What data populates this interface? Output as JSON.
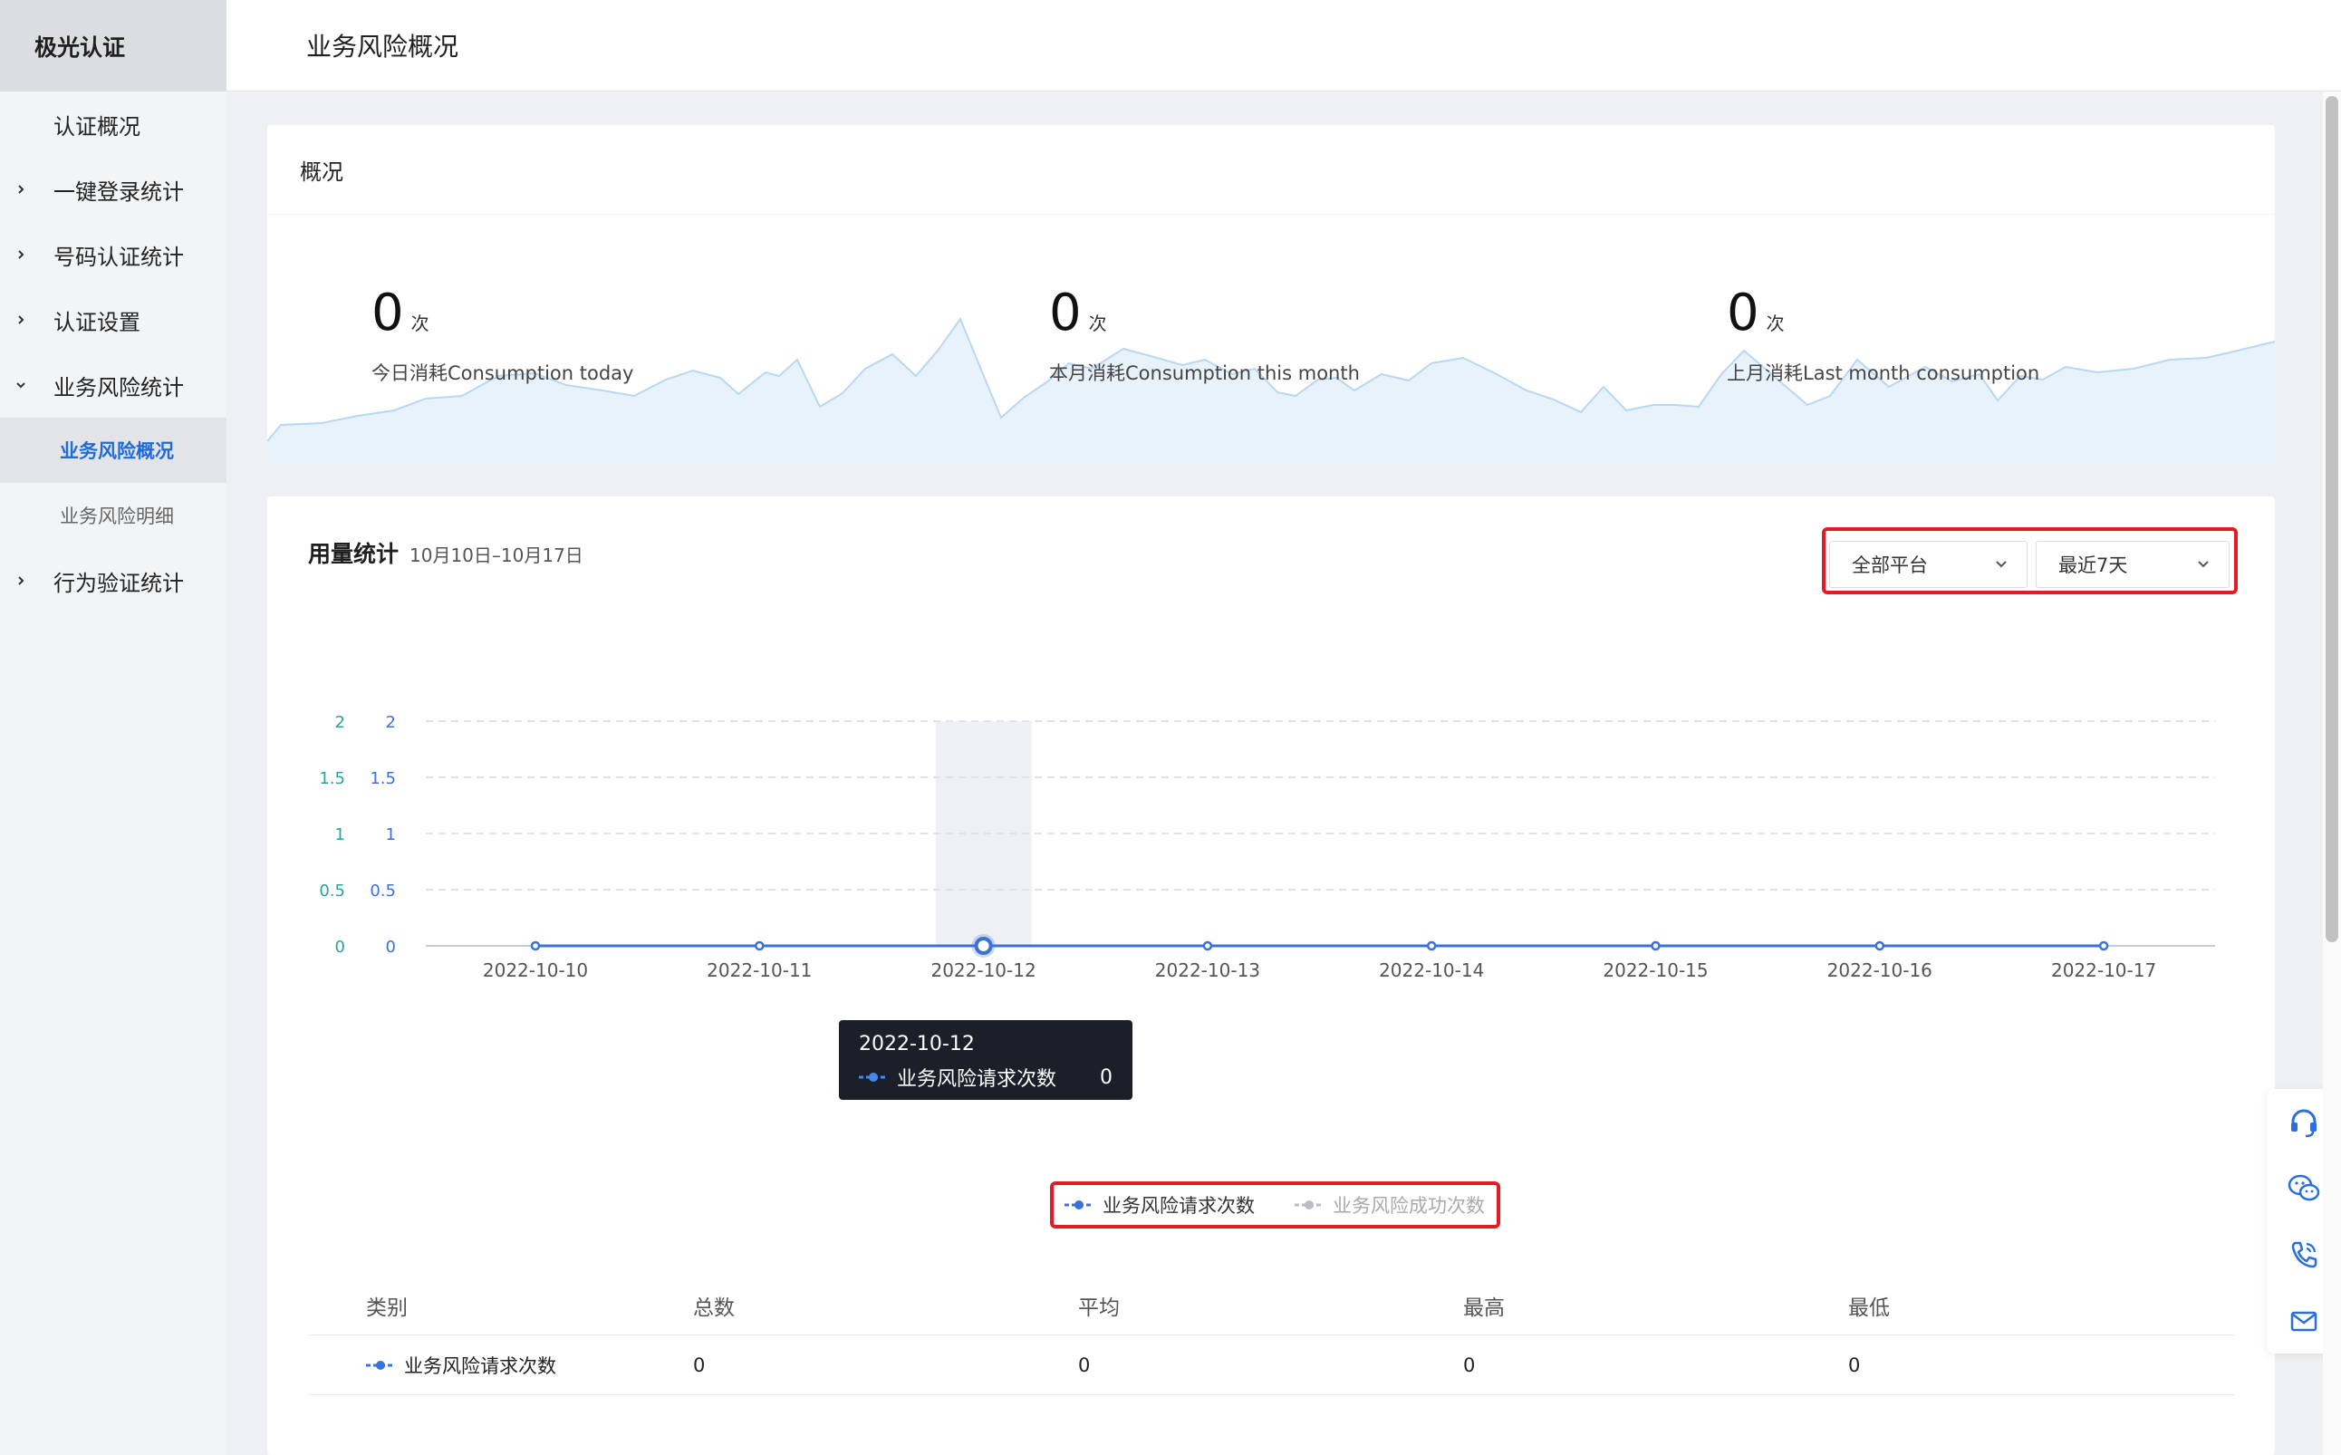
{
  "brand": "极光认证",
  "sidebar": {
    "items": [
      {
        "label": "认证概况"
      },
      {
        "label": "一键登录统计"
      },
      {
        "label": "号码认证统计"
      },
      {
        "label": "认证设置"
      },
      {
        "label": "业务风险统计"
      },
      {
        "label": "行为验证统计"
      }
    ],
    "sub_items": [
      {
        "label": "业务风险概况",
        "active": true
      },
      {
        "label": "业务风险明细",
        "active": false
      }
    ]
  },
  "header": {
    "title": "业务风险概况"
  },
  "overview": {
    "title": "概况",
    "stats": [
      {
        "value": "0",
        "unit": "次",
        "label": "今日消耗Consumption today"
      },
      {
        "value": "0",
        "unit": "次",
        "label": "本月消耗Consumption this month"
      },
      {
        "value": "0",
        "unit": "次",
        "label": "上月消耗Last month consumption"
      }
    ]
  },
  "usage": {
    "title": "用量统计",
    "date_range": "10月10日–10月17日",
    "platform_select": "全部平台",
    "period_select": "最近7天"
  },
  "chart_data": {
    "type": "line",
    "x": [
      "2022-10-10",
      "2022-10-11",
      "2022-10-12",
      "2022-10-13",
      "2022-10-14",
      "2022-10-15",
      "2022-10-16",
      "2022-10-17"
    ],
    "series": [
      {
        "name": "业务风险请求次数",
        "values": [
          0,
          0,
          0,
          0,
          0,
          0,
          0,
          0
        ],
        "color": "#3a72d9",
        "active": true
      },
      {
        "name": "业务风险成功次数",
        "values": [
          0,
          0,
          0,
          0,
          0,
          0,
          0,
          0
        ],
        "color": "#b8bcc4",
        "active": false
      }
    ],
    "y_ticks": [
      "0",
      "0.5",
      "1",
      "1.5",
      "2"
    ],
    "ylim": [
      0,
      2
    ],
    "dual_y_axis": true,
    "left_axis_color": "#2aa39a",
    "right_axis_color": "#3a72d9",
    "grid": true,
    "highlight_index": 2,
    "tooltip": {
      "date": "2022-10-12",
      "series": "业务风险请求次数",
      "value": "0"
    }
  },
  "table": {
    "headers": [
      "类别",
      "总数",
      "平均",
      "最高",
      "最低"
    ],
    "rows": [
      {
        "category": "业务风险请求次数",
        "total": "0",
        "average": "0",
        "max": "0",
        "min": "0"
      }
    ]
  },
  "float_toolbar": {
    "icons": [
      "headset-icon",
      "wechat-icon",
      "phone-icon",
      "mail-icon"
    ]
  }
}
